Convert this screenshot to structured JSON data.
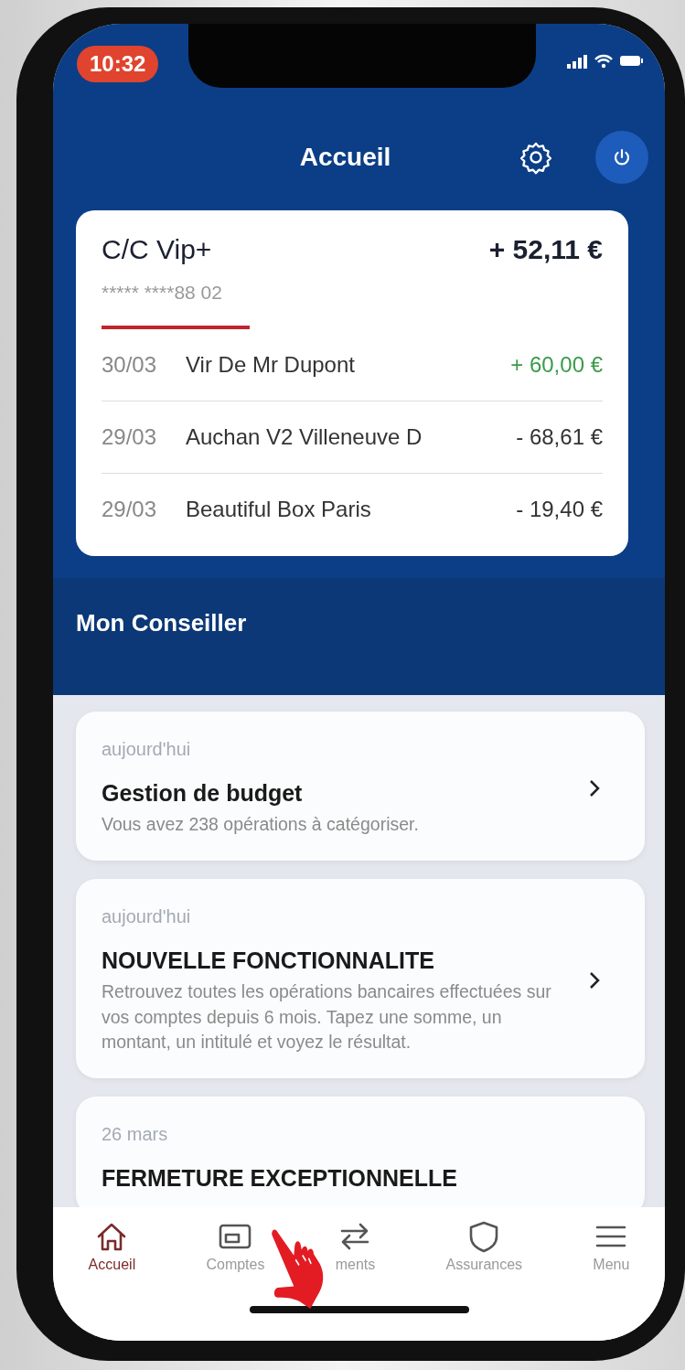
{
  "status_bar": {
    "time": "10:32"
  },
  "header": {
    "title": "Accueil"
  },
  "account": {
    "name": "C/C Vip+",
    "balance": "+ 52,11 €",
    "number": "***** ****88 02",
    "transactions": [
      {
        "date": "30/03",
        "label": "Vir De Mr Dupont",
        "amount": "+ 60,00 €",
        "kind": "credit"
      },
      {
        "date": "29/03",
        "label": "Auchan V2 Villeneuve D",
        "amount": "- 68,61 €",
        "kind": "debit"
      },
      {
        "date": "29/03",
        "label": "Beautiful Box Paris",
        "amount": "- 19,40 €",
        "kind": "debit"
      }
    ]
  },
  "section_title": "Mon Conseiller",
  "messages": [
    {
      "date": "aujourd'hui",
      "title": "Gestion de budget",
      "body": "Vous avez 238 opérations à catégoriser.",
      "chevron": true
    },
    {
      "date": "aujourd'hui",
      "title": "NOUVELLE FONCTIONNALITE",
      "body": "Retrouvez toutes les opérations bancaires effectuées sur vos comptes depuis 6 mois. Tapez une somme, un montant, un intitulé et voyez le résultat.",
      "chevron": true
    },
    {
      "date": "26 mars",
      "title": "FERMETURE EXCEPTIONNELLE",
      "chevron": false
    }
  ],
  "tabs": [
    {
      "label": "Accueil",
      "kind": "home",
      "selected": true
    },
    {
      "label": "Comptes",
      "kind": "card",
      "selected": false
    },
    {
      "label": "ments",
      "kind": "transfer",
      "selected": false
    },
    {
      "label": "Assurances",
      "kind": "shield",
      "selected": false
    },
    {
      "label": "Menu",
      "kind": "menu",
      "selected": false
    }
  ]
}
